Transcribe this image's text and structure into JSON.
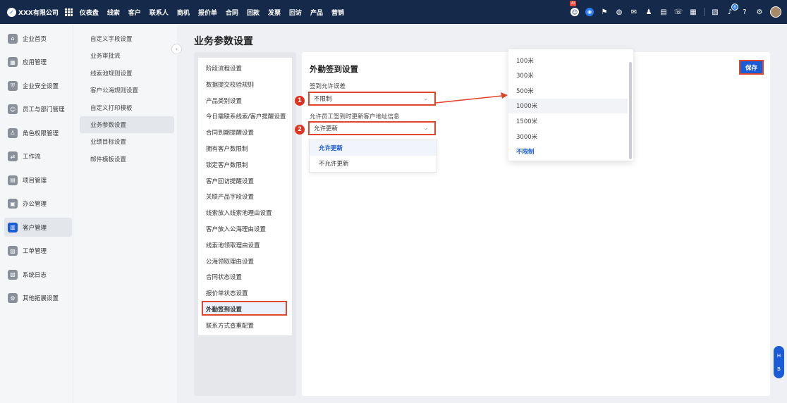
{
  "brand": {
    "name": "XXX有限公司",
    "logo_glyph": "✓"
  },
  "top_nav": [
    "仪表盘",
    "线索",
    "客户",
    "联系人",
    "商机",
    "报价单",
    "合同",
    "回款",
    "发票",
    "回访",
    "产品",
    "营销"
  ],
  "top_icons": {
    "ai_badge": "AI",
    "notification_count": "6"
  },
  "left_nav": [
    {
      "label": "企业首页",
      "icon": "home-icon",
      "glyph": "⌂"
    },
    {
      "label": "应用管理",
      "icon": "apps-icon",
      "glyph": "▦"
    },
    {
      "label": "企业安全设置",
      "icon": "shield-icon",
      "glyph": "⛨"
    },
    {
      "label": "员工与部门管理",
      "icon": "users-icon",
      "glyph": "☺"
    },
    {
      "label": "角色权限管理",
      "icon": "role-icon",
      "glyph": "♙"
    },
    {
      "label": "工作流",
      "icon": "workflow-icon",
      "glyph": "⇄"
    },
    {
      "label": "项目管理",
      "icon": "project-icon",
      "glyph": "▤"
    },
    {
      "label": "办公管理",
      "icon": "office-icon",
      "glyph": "▣"
    },
    {
      "label": "客户管理",
      "icon": "customer-icon",
      "glyph": "▥",
      "active": true
    },
    {
      "label": "工单管理",
      "icon": "ticket-icon",
      "glyph": "▧"
    },
    {
      "label": "系统日志",
      "icon": "log-icon",
      "glyph": "▨"
    },
    {
      "label": "其他拓展设置",
      "icon": "extension-icon",
      "glyph": "⚙"
    }
  ],
  "sub_nav": [
    {
      "label": "自定义字段设置"
    },
    {
      "label": "业务审批流"
    },
    {
      "label": "线索池规则设置"
    },
    {
      "label": "客户公海规则设置"
    },
    {
      "label": "自定义打印模板"
    },
    {
      "label": "业务参数设置",
      "active": true
    },
    {
      "label": "业绩目标设置"
    },
    {
      "label": "邮件模板设置"
    }
  ],
  "page_title": "业务参数设置",
  "param_list": [
    "阶段流程设置",
    "数据提交校验规则",
    "产品类别设置",
    "今日需联系线索/客户提醒设置",
    "合同到期提醒设置",
    "拥有客户数限制",
    "锁定客户数限制",
    "客户回访提醒设置",
    "关联产品字段设置",
    "线索放入线索池理由设置",
    "客户放入公海理由设置",
    "线索池领取理由设置",
    "公海领取理由设置",
    "合同状态设置",
    "报价单状态设置",
    "外勤签到设置",
    "联系方式查重配置"
  ],
  "param_list_selected": "外勤签到设置",
  "section": {
    "title": "外勤签到设置",
    "field1_label": "签到允许误差",
    "field1_value": "不限制",
    "field2_label": "允许员工签到时更新客户地址信息",
    "field2_value": "允许更新",
    "badge1": "1",
    "badge2": "2"
  },
  "dropdown_distance": {
    "options": [
      "100米",
      "300米",
      "500米",
      "1000米",
      "1500米",
      "3000米",
      "不限制"
    ],
    "selected": "不限制",
    "hovered": "1000米"
  },
  "dropdown_update": {
    "options": [
      "允许更新",
      "不允许更新"
    ],
    "selected": "允许更新"
  },
  "save_label": "保存",
  "float_bar": [
    "H",
    "B"
  ],
  "colors": {
    "primary": "#1a5bd8",
    "topbar": "#152a4a",
    "annotation_red": "#e0462b"
  }
}
